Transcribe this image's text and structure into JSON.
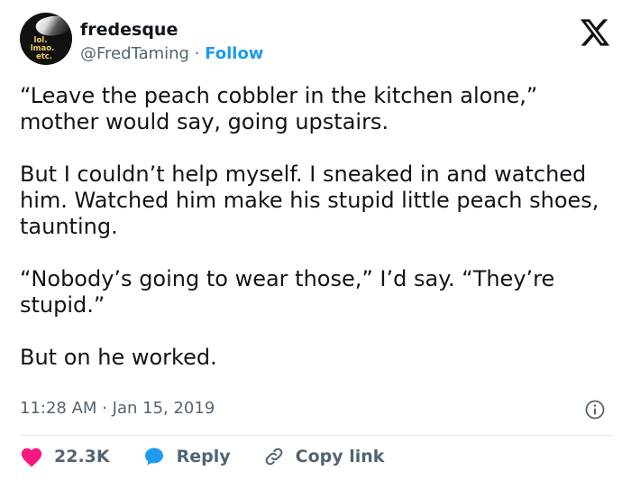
{
  "user": {
    "name": "fredesque",
    "handle": "@FredTaming",
    "separator": "·",
    "follow_label": "Follow",
    "avatar_lines": [
      "lol.",
      "lmao.",
      "etc."
    ]
  },
  "tweet": {
    "text": "“Leave the peach cobbler in the kitchen alone,” mother would say, going upstairs.\n\nBut I couldn’t help myself. I sneaked in and watched him. Watched him make his stupid little peach shoes, taunting.\n\n“Nobody’s going to wear those,” I’d say. “They’re stupid.”\n\nBut on he worked."
  },
  "meta": {
    "time": "11:28 AM",
    "separator": "·",
    "date": "Jan 15, 2019"
  },
  "actions": {
    "like_count": "22.3K",
    "reply_label": "Reply",
    "copy_label": "Copy link"
  },
  "colors": {
    "follow": "#1d9bf0",
    "like": "#f91880",
    "reply": "#1d9bf0",
    "secondary": "#536471"
  }
}
